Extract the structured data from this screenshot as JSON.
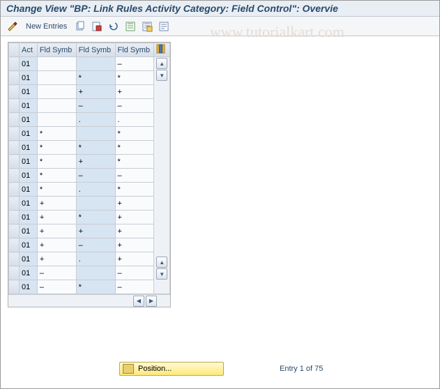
{
  "title": "Change View \"BP: Link Rules Activity Category: Field Control\": Overvie",
  "watermark": "www.tutorialkart.com",
  "toolbar": {
    "new_entries": "New Entries"
  },
  "grid": {
    "headers": [
      "Act",
      "Fld Symb",
      "Fld Symb",
      "Fld Symb"
    ],
    "rows": [
      {
        "act": "01",
        "c1": "",
        "c2": "",
        "c3": "–"
      },
      {
        "act": "01",
        "c1": "",
        "c2": "*",
        "c3": "*"
      },
      {
        "act": "01",
        "c1": "",
        "c2": "+",
        "c3": "+"
      },
      {
        "act": "01",
        "c1": "",
        "c2": "–",
        "c3": "–"
      },
      {
        "act": "01",
        "c1": "",
        "c2": ".",
        "c3": "."
      },
      {
        "act": "01",
        "c1": "*",
        "c2": "",
        "c3": "*"
      },
      {
        "act": "01",
        "c1": "*",
        "c2": "*",
        "c3": "*"
      },
      {
        "act": "01",
        "c1": "*",
        "c2": "+",
        "c3": "*"
      },
      {
        "act": "01",
        "c1": "*",
        "c2": "–",
        "c3": "–"
      },
      {
        "act": "01",
        "c1": "*",
        "c2": ".",
        "c3": "*"
      },
      {
        "act": "01",
        "c1": "+",
        "c2": "",
        "c3": "+"
      },
      {
        "act": "01",
        "c1": "+",
        "c2": "*",
        "c3": "+"
      },
      {
        "act": "01",
        "c1": "+",
        "c2": "+",
        "c3": "+"
      },
      {
        "act": "01",
        "c1": "+",
        "c2": "–",
        "c3": "+"
      },
      {
        "act": "01",
        "c1": "+",
        "c2": ".",
        "c3": "+"
      },
      {
        "act": "01",
        "c1": "–",
        "c2": "",
        "c3": "–"
      },
      {
        "act": "01",
        "c1": "–",
        "c2": "*",
        "c3": "–"
      }
    ]
  },
  "footer": {
    "position_label": "Position...",
    "entry_text": "Entry 1 of 75"
  }
}
